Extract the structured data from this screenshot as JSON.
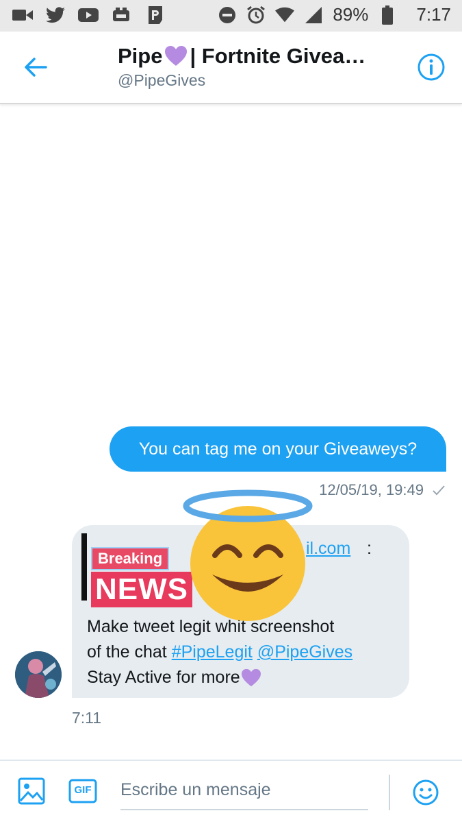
{
  "status_bar": {
    "battery": "89%",
    "time": "7:17",
    "left_icons": [
      "video-camera-icon",
      "twitter-icon",
      "youtube-icon",
      "game-icon",
      "p-app-icon"
    ],
    "right_icons": [
      "do-not-disturb-icon",
      "alarm-icon",
      "wifi-icon",
      "signal-icon",
      "battery-icon"
    ]
  },
  "header": {
    "title_part1": "Pipe",
    "title_part2": "| Fortnite Givea…",
    "handle": "@PipeGives",
    "back_icon": "arrow-left-icon",
    "info_icon": "info-icon"
  },
  "conversation": {
    "outgoing": {
      "text": "You can tag me on your Giveaweys?",
      "timestamp": "12/05/19, 19:49"
    },
    "incoming": {
      "news_badge_top": "Breaking",
      "news_badge_bottom": "NEWS",
      "email_fragment": "il.com",
      "colon": ":",
      "line1": "Make tweet legit whit screenshot",
      "line2_text": "of the chat ",
      "hashtag": "#PipeLegit",
      "mention": "@PipeGives",
      "line3": "Stay Active for more",
      "time": "7:11"
    }
  },
  "composer": {
    "placeholder": "Escribe un mensaje",
    "gif_label": "GIF"
  },
  "colors": {
    "accent": "#1da1f2",
    "bubble_incoming": "#e6ecf0",
    "heart": "#b48be0",
    "emoji_face": "#f9c33a",
    "halo": "#5aa9e6"
  }
}
